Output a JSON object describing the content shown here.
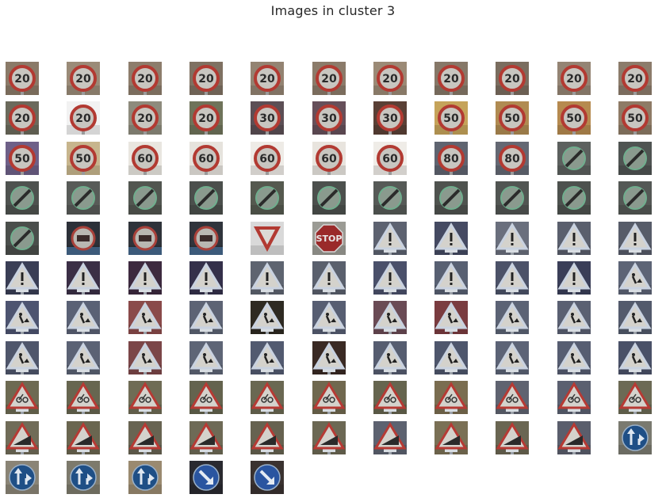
{
  "figure": {
    "title": "Images in cluster 3",
    "rows": [
      [
        {
          "sign": "limit",
          "value": "20",
          "bg": "#8a7a68"
        },
        {
          "sign": "limit",
          "value": "20",
          "bg": "#9a8b78"
        },
        {
          "sign": "limit",
          "value": "20",
          "bg": "#8d7d6c"
        },
        {
          "sign": "limit",
          "value": "20",
          "bg": "#7f7162"
        },
        {
          "sign": "limit",
          "value": "20",
          "bg": "#938372"
        },
        {
          "sign": "limit",
          "value": "20",
          "bg": "#8b7b6a"
        },
        {
          "sign": "limit",
          "value": "20",
          "bg": "#9b8a76"
        },
        {
          "sign": "limit",
          "value": "20",
          "bg": "#867868"
        },
        {
          "sign": "limit",
          "value": "20",
          "bg": "#7a6d5f"
        },
        {
          "sign": "limit",
          "value": "20",
          "bg": "#948474"
        },
        {
          "sign": "limit",
          "value": "20",
          "bg": "#8c7c6b"
        }
      ],
      [
        {
          "sign": "limit",
          "value": "20",
          "bg": "#6b6a5c"
        },
        {
          "sign": "limit",
          "value": "20",
          "bg": "#f2f2f2"
        },
        {
          "sign": "limit",
          "value": "20",
          "bg": "#8e8b7d"
        },
        {
          "sign": "limit",
          "value": "20",
          "bg": "#6f735a"
        },
        {
          "sign": "limit",
          "value": "30",
          "bg": "#5c4f55"
        },
        {
          "sign": "limit",
          "value": "30",
          "bg": "#66505a"
        },
        {
          "sign": "limit",
          "value": "30",
          "bg": "#5a4036"
        },
        {
          "sign": "limit",
          "value": "50",
          "bg": "#c5a35a"
        },
        {
          "sign": "limit",
          "value": "50",
          "bg": "#b08b52"
        },
        {
          "sign": "limit",
          "value": "50",
          "bg": "#b68a4f"
        },
        {
          "sign": "limit",
          "value": "50",
          "bg": "#8e7b66"
        }
      ],
      [
        {
          "sign": "limit",
          "value": "50",
          "bg": "#6e6088"
        },
        {
          "sign": "limit",
          "value": "50",
          "bg": "#c7b58d"
        },
        {
          "sign": "limit",
          "value": "60",
          "bg": "#e9e6e0"
        },
        {
          "sign": "limit",
          "value": "60",
          "bg": "#e6e3dd"
        },
        {
          "sign": "limit",
          "value": "60",
          "bg": "#eeebe6"
        },
        {
          "sign": "limit",
          "value": "60",
          "bg": "#e8e4de"
        },
        {
          "sign": "limit",
          "value": "60",
          "bg": "#efece7"
        },
        {
          "sign": "limit",
          "value": "80",
          "bg": "#5f6470"
        },
        {
          "sign": "limit",
          "value": "80",
          "bg": "#646873"
        },
        {
          "sign": "endlimit",
          "value": "",
          "bg": "#5c605e"
        },
        {
          "sign": "endlimit",
          "value": "",
          "bg": "#4f5452"
        }
      ],
      [
        {
          "sign": "endlimit",
          "value": "",
          "bg": "#4e524f"
        },
        {
          "sign": "endlimit",
          "value": "",
          "bg": "#585b58"
        },
        {
          "sign": "endlimit",
          "value": "",
          "bg": "#525650"
        },
        {
          "sign": "endlimit",
          "value": "",
          "bg": "#4b4f4c"
        },
        {
          "sign": "endlimit",
          "value": "",
          "bg": "#55594f"
        },
        {
          "sign": "endlimit",
          "value": "",
          "bg": "#4c504d"
        },
        {
          "sign": "endlimit",
          "value": "",
          "bg": "#565a57"
        },
        {
          "sign": "endlimit",
          "value": "",
          "bg": "#4f534f"
        },
        {
          "sign": "endlimit",
          "value": "",
          "bg": "#515552"
        },
        {
          "sign": "endlimit",
          "value": "",
          "bg": "#4d514e"
        },
        {
          "sign": "endlimit",
          "value": "",
          "bg": "#545855"
        }
      ],
      [
        {
          "sign": "endlimit",
          "value": "",
          "bg": "#4a4e4b"
        },
        {
          "sign": "truck",
          "value": "",
          "bg": "#2c3038"
        },
        {
          "sign": "truck",
          "value": "",
          "bg": "#2f333a"
        },
        {
          "sign": "truck",
          "value": "",
          "bg": "#30343c"
        },
        {
          "sign": "yield",
          "value": "",
          "bg": "#d9d9d9"
        },
        {
          "sign": "stop",
          "value": "",
          "bg": "#9b9b94"
        },
        {
          "sign": "warn",
          "value": "",
          "bg": "#5d6270"
        },
        {
          "sign": "warn",
          "value": "",
          "bg": "#454a62"
        },
        {
          "sign": "warn",
          "value": "",
          "bg": "#6a6f7d"
        },
        {
          "sign": "warn",
          "value": "",
          "bg": "#5a5f6d"
        },
        {
          "sign": "warn",
          "value": "",
          "bg": "#575c69"
        }
      ],
      [
        {
          "sign": "warn",
          "value": "",
          "bg": "#3a3e55"
        },
        {
          "sign": "warn",
          "value": "",
          "bg": "#3b2f46"
        },
        {
          "sign": "warn",
          "value": "",
          "bg": "#3d2a3f"
        },
        {
          "sign": "warn",
          "value": "",
          "bg": "#34304a"
        },
        {
          "sign": "warn",
          "value": "",
          "bg": "#5e6470"
        },
        {
          "sign": "warn",
          "value": "",
          "bg": "#5a606d"
        },
        {
          "sign": "warn",
          "value": "",
          "bg": "#4a506a"
        },
        {
          "sign": "warn",
          "value": "",
          "bg": "#586072"
        },
        {
          "sign": "warn",
          "value": "",
          "bg": "#4c5268"
        },
        {
          "sign": "warn",
          "value": "",
          "bg": "#3a3e58"
        },
        {
          "sign": "works",
          "value": "",
          "bg": "#5d6476"
        }
      ],
      [
        {
          "sign": "works",
          "value": "",
          "bg": "#4d5470"
        },
        {
          "sign": "works",
          "value": "",
          "bg": "#5a6175"
        },
        {
          "sign": "works",
          "value": "",
          "bg": "#8a4a4a"
        },
        {
          "sign": "works",
          "value": "",
          "bg": "#5d6374"
        },
        {
          "sign": "works",
          "value": "",
          "bg": "#2e2a22"
        },
        {
          "sign": "works",
          "value": "",
          "bg": "#575e72"
        },
        {
          "sign": "works",
          "value": "",
          "bg": "#6a4b55"
        },
        {
          "sign": "works",
          "value": "",
          "bg": "#7a3c40"
        },
        {
          "sign": "works",
          "value": "",
          "bg": "#5c6375"
        },
        {
          "sign": "works",
          "value": "",
          "bg": "#5a6072"
        },
        {
          "sign": "works",
          "value": "",
          "bg": "#535a6c"
        }
      ],
      [
        {
          "sign": "works",
          "value": "",
          "bg": "#4f566b"
        },
        {
          "sign": "works",
          "value": "",
          "bg": "#5b6274"
        },
        {
          "sign": "works",
          "value": "",
          "bg": "#7b4648"
        },
        {
          "sign": "works",
          "value": "",
          "bg": "#5e6576"
        },
        {
          "sign": "works",
          "value": "",
          "bg": "#525a70"
        },
        {
          "sign": "works",
          "value": "",
          "bg": "#3a2a24"
        },
        {
          "sign": "works",
          "value": "",
          "bg": "#565d70"
        },
        {
          "sign": "works",
          "value": "",
          "bg": "#4e566c"
        },
        {
          "sign": "works",
          "value": "",
          "bg": "#5c6376"
        },
        {
          "sign": "works",
          "value": "",
          "bg": "#565d71"
        },
        {
          "sign": "works",
          "value": "",
          "bg": "#4a5168"
        }
      ],
      [
        {
          "sign": "warnred",
          "value": "",
          "bg": "#6d6a52"
        },
        {
          "sign": "warnred",
          "value": "",
          "bg": "#676650"
        },
        {
          "sign": "warnred",
          "value": "",
          "bg": "#6f6c55"
        },
        {
          "sign": "warnred",
          "value": "",
          "bg": "#64634e"
        },
        {
          "sign": "warnred",
          "value": "",
          "bg": "#6a6852"
        },
        {
          "sign": "warnred",
          "value": "",
          "bg": "#70684f"
        },
        {
          "sign": "warnred",
          "value": "",
          "bg": "#66654f"
        },
        {
          "sign": "warnred",
          "value": "",
          "bg": "#7a6d50"
        },
        {
          "sign": "warnred",
          "value": "",
          "bg": "#5f6370"
        },
        {
          "sign": "warnred",
          "value": "",
          "bg": "#5b6070"
        },
        {
          "sign": "warnred",
          "value": "",
          "bg": "#6c6a55"
        }
      ],
      [
        {
          "sign": "slope",
          "value": "",
          "bg": "#706c58"
        },
        {
          "sign": "slope",
          "value": "",
          "bg": "#6a6650"
        },
        {
          "sign": "slope",
          "value": "",
          "bg": "#686452"
        },
        {
          "sign": "slope",
          "value": "",
          "bg": "#6e6a56"
        },
        {
          "sign": "slope",
          "value": "",
          "bg": "#666250"
        },
        {
          "sign": "slope",
          "value": "",
          "bg": "#6c6854"
        },
        {
          "sign": "slope",
          "value": "",
          "bg": "#5d6270"
        },
        {
          "sign": "slope",
          "value": "",
          "bg": "#7a7055"
        },
        {
          "sign": "slope",
          "value": "",
          "bg": "#6a6652"
        },
        {
          "sign": "slope",
          "value": "",
          "bg": "#5a5e6c"
        },
        {
          "sign": "blue",
          "value": "",
          "bg": "#7a7a70"
        }
      ],
      [
        {
          "sign": "blue",
          "value": "",
          "bg": "#8a8476"
        },
        {
          "sign": "blue",
          "value": "",
          "bg": "#7d7a6c"
        },
        {
          "sign": "blue",
          "value": "",
          "bg": "#9a8a70"
        },
        {
          "sign": "bluearrow",
          "value": "",
          "bg": "#2a2a30"
        },
        {
          "sign": "bluearrow",
          "value": "",
          "bg": "#3a3230"
        }
      ]
    ]
  }
}
